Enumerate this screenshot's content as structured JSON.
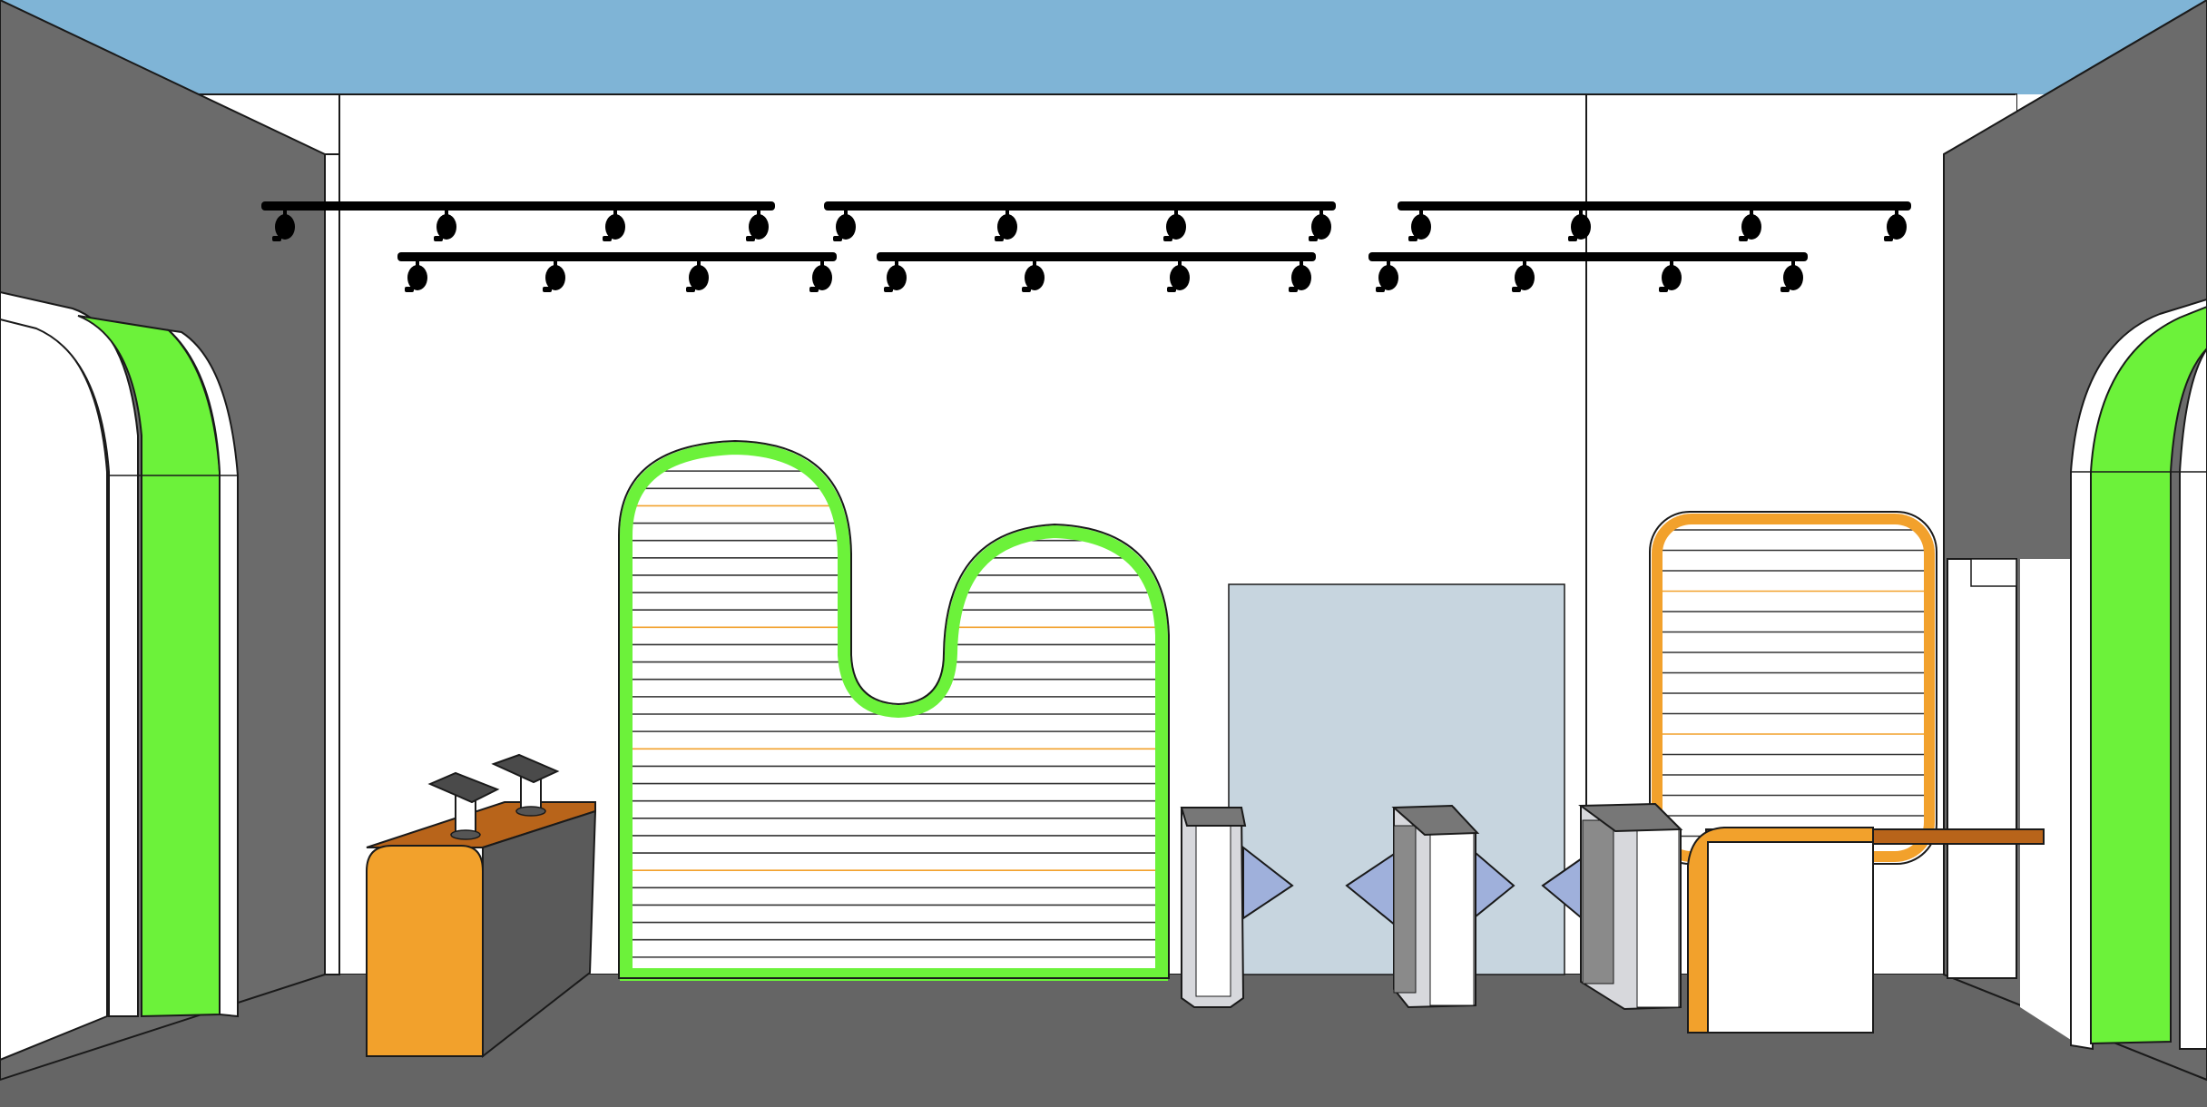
{
  "scene": {
    "description_free": true,
    "colors": {
      "sky": "#7fb4d6",
      "back_wall": "#ffffff",
      "side_wall": "#6b6b6b",
      "floor": "#656565",
      "green_accent": "#6cf23a",
      "orange_accent": "#f2a12c",
      "counter_top": "#b8641a",
      "glass_panel": "#c7d5df",
      "gate_body": "#d7d8dc",
      "gate_dark": "#8a8a8a",
      "gate_flap": "#9fb0db",
      "track": "#000000",
      "outline": "#1a1a1a"
    },
    "light_tracks": [
      {
        "lights": 4
      },
      {
        "lights": 4
      },
      {
        "lights": 4
      },
      {
        "lights": 4
      },
      {
        "lights": 4
      },
      {
        "lights": 4
      }
    ],
    "shutter_large": {
      "accent": "green",
      "slats": 30
    },
    "shutter_small": {
      "accent": "orange",
      "slats": 16
    },
    "turnstiles": 3,
    "kiosks": 2
  }
}
